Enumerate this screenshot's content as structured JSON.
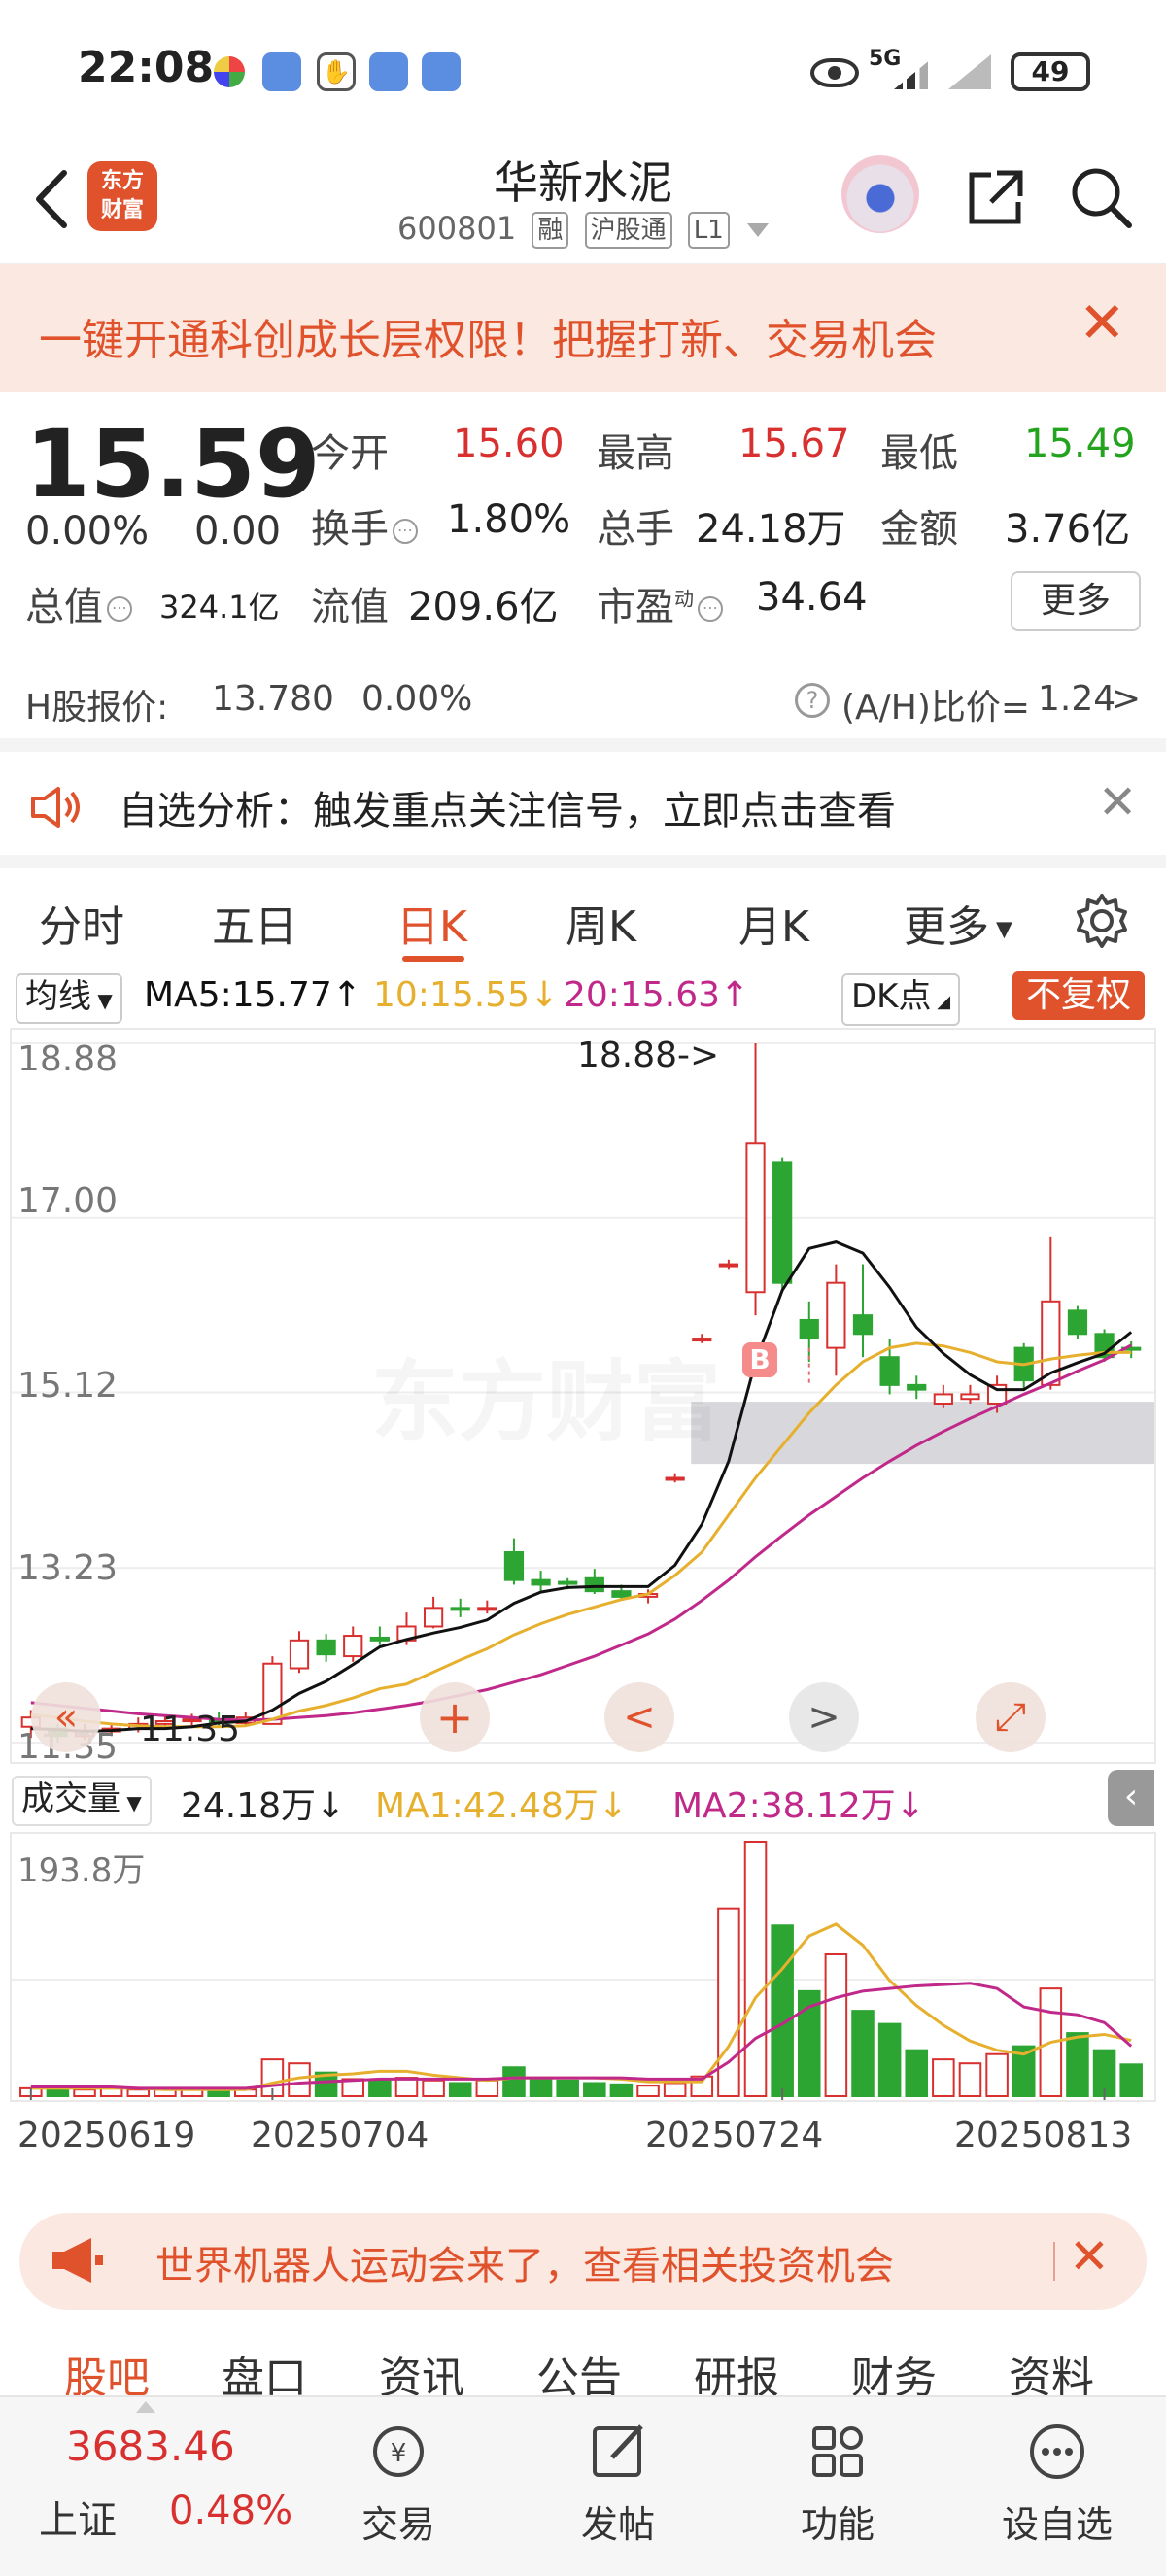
{
  "status_bar": {
    "time": "22:08",
    "network": "5G",
    "battery": "49"
  },
  "header": {
    "logo_line1": "东方",
    "logo_line2": "财富",
    "stock_name": "华新水泥",
    "stock_code": "600801",
    "tags": [
      "融",
      "沪股通",
      "L1"
    ]
  },
  "promo_banner": {
    "text": "一键开通科创成长层权限！把握打新、交易机会"
  },
  "quote": {
    "price": "15.59",
    "change_pct": "0.00%",
    "change": "0.00",
    "open_label": "今开",
    "open": "15.60",
    "high_label": "最高",
    "high": "15.67",
    "low_label": "最低",
    "low": "15.49",
    "turnover_label": "换手",
    "turnover": "1.80%",
    "volume_label": "总手",
    "volume": "24.18万",
    "amount_label": "金额",
    "amount": "3.76亿",
    "mktcap_label": "总值",
    "mktcap": "324.1亿",
    "float_label": "流值",
    "float": "209.6亿",
    "pe_label": "市盈",
    "pe_sup": "动",
    "pe": "34.64",
    "more": "更多"
  },
  "hk": {
    "label": "H股报价:",
    "price": "13.780",
    "pct": "0.00%",
    "ratio_label": "(A/H)比价=",
    "ratio": "1.24",
    "arrow": ">"
  },
  "analysis": {
    "text": "自选分析：触发重点关注信号，立即点击查看"
  },
  "tabs": [
    "分时",
    "五日",
    "日K",
    "周K",
    "月K",
    "更多"
  ],
  "ma_row": {
    "selector": "均线",
    "ma5": "MA5:15.77↑",
    "ma10": "10:15.55↓",
    "ma20": "20:15.63↑",
    "dk": "DK点",
    "fq": "不复权"
  },
  "colors": {
    "up": "#d8302f",
    "down": "#2da532",
    "accent": "#e0522c",
    "ma5": "#111111",
    "ma10": "#e6b02e",
    "ma20": "#c0288a"
  },
  "chart_data": [
    {
      "type": "candlestick",
      "y_ticks": [
        "18.88",
        "17.00",
        "15.12",
        "13.23",
        "11.35"
      ],
      "ylim": [
        11.35,
        18.88
      ],
      "max_label": "18.88->",
      "min_label": "11.35",
      "candles": [
        [
          11.52,
          11.62,
          11.7,
          11.4
        ],
        [
          11.5,
          11.42,
          11.55,
          11.35
        ],
        [
          11.42,
          11.48,
          11.55,
          11.38
        ],
        [
          11.47,
          11.5,
          11.56,
          11.42
        ],
        [
          11.5,
          11.55,
          11.62,
          11.46
        ],
        [
          11.55,
          11.58,
          11.64,
          11.5
        ],
        [
          11.58,
          11.6,
          11.66,
          11.52
        ],
        [
          11.6,
          11.56,
          11.68,
          11.52
        ],
        [
          11.56,
          11.62,
          11.68,
          11.52
        ],
        [
          11.55,
          12.2,
          12.28,
          11.55
        ],
        [
          12.15,
          12.45,
          12.55,
          12.1
        ],
        [
          12.45,
          12.3,
          12.52,
          12.22
        ],
        [
          12.28,
          12.5,
          12.6,
          12.22
        ],
        [
          12.48,
          12.45,
          12.6,
          12.4
        ],
        [
          12.45,
          12.6,
          12.75,
          12.4
        ],
        [
          12.6,
          12.8,
          12.92,
          12.58
        ],
        [
          12.8,
          12.78,
          12.9,
          12.7
        ],
        [
          12.78,
          12.8,
          12.88,
          12.74
        ],
        [
          13.4,
          13.1,
          13.55,
          13.05
        ],
        [
          13.1,
          13.05,
          13.2,
          12.98
        ],
        [
          13.08,
          13.06,
          13.12,
          13.0
        ],
        [
          13.12,
          12.98,
          13.22,
          12.95
        ],
        [
          12.98,
          12.92,
          13.05,
          12.88
        ],
        [
          12.92,
          12.95,
          13.0,
          12.85
        ],
        [
          14.2,
          14.2,
          14.25,
          14.15
        ],
        [
          15.7,
          15.7,
          15.75,
          15.65
        ],
        [
          16.5,
          16.5,
          16.55,
          16.45
        ],
        [
          16.2,
          17.8,
          18.88,
          15.95
        ],
        [
          17.6,
          16.3,
          17.65,
          16.2
        ],
        [
          15.9,
          15.7,
          16.1,
          15.45
        ],
        [
          15.6,
          16.3,
          16.5,
          15.3
        ],
        [
          15.95,
          15.75,
          16.5,
          15.5
        ],
        [
          15.5,
          15.2,
          15.7,
          15.1
        ],
        [
          15.2,
          15.15,
          15.3,
          15.05
        ],
        [
          15.0,
          15.1,
          15.2,
          14.95
        ],
        [
          15.05,
          15.1,
          15.2,
          15.0
        ],
        [
          15.0,
          15.2,
          15.3,
          14.9
        ],
        [
          15.6,
          15.25,
          15.65,
          15.15
        ],
        [
          15.2,
          16.1,
          16.8,
          15.15
        ],
        [
          16.0,
          15.75,
          16.05,
          15.7
        ],
        [
          15.75,
          15.5,
          15.8,
          15.45
        ],
        [
          15.6,
          15.59,
          15.67,
          15.49
        ]
      ],
      "ma5": [
        11.5,
        11.49,
        11.47,
        11.48,
        11.5,
        11.5,
        11.52,
        11.56,
        11.58,
        11.7,
        11.88,
        12.01,
        12.19,
        12.38,
        12.46,
        12.53,
        12.59,
        12.67,
        12.85,
        12.97,
        13.02,
        13.03,
        13.03,
        13.03,
        13.26,
        13.7,
        14.38,
        15.45,
        16.22,
        16.67,
        16.74,
        16.62,
        16.25,
        15.82,
        15.54,
        15.31,
        15.15,
        15.15,
        15.33,
        15.44,
        15.54,
        15.77
      ],
      "ma10": [
        11.65,
        11.62,
        11.58,
        11.55,
        11.53,
        11.52,
        11.52,
        11.52,
        11.53,
        11.6,
        11.69,
        11.75,
        11.83,
        11.93,
        11.98,
        12.11,
        12.24,
        12.36,
        12.51,
        12.63,
        12.73,
        12.81,
        12.89,
        12.95,
        13.15,
        13.4,
        13.8,
        14.2,
        14.55,
        14.9,
        15.2,
        15.45,
        15.6,
        15.65,
        15.62,
        15.55,
        15.45,
        15.42,
        15.48,
        15.52,
        15.55,
        15.55
      ],
      "ma20": [
        11.78,
        11.75,
        11.72,
        11.69,
        11.66,
        11.64,
        11.62,
        11.6,
        11.59,
        11.6,
        11.62,
        11.64,
        11.67,
        11.71,
        11.75,
        11.8,
        11.86,
        11.92,
        12.0,
        12.08,
        12.18,
        12.28,
        12.4,
        12.52,
        12.68,
        12.88,
        13.1,
        13.35,
        13.58,
        13.8,
        14.0,
        14.2,
        14.38,
        14.55,
        14.7,
        14.84,
        14.97,
        15.1,
        15.22,
        15.35,
        15.47,
        15.63
      ]
    },
    {
      "type": "bar",
      "name": "成交量",
      "ymax_label": "193.8万",
      "ylim": [
        0,
        193.8
      ],
      "values": [
        6,
        5,
        5,
        6,
        5,
        5,
        6,
        5,
        5,
        28,
        25,
        18,
        13,
        12,
        14,
        12,
        10,
        12,
        22,
        14,
        12,
        10,
        9,
        8,
        10,
        15,
        143,
        193.8,
        130,
        80,
        108,
        65,
        55,
        35,
        28,
        25,
        32,
        38,
        82,
        48,
        35,
        24.18
      ],
      "ma1": [
        6,
        6,
        6,
        6,
        6,
        5,
        5,
        5,
        5,
        10,
        14,
        16,
        17,
        19,
        19,
        16,
        14,
        12,
        14,
        14,
        14,
        14,
        13,
        11,
        11,
        11,
        38,
        75,
        97,
        122,
        131,
        115,
        88,
        69,
        54,
        42,
        35,
        32,
        41,
        45,
        47,
        42.48
      ],
      "ma2": [
        7,
        7,
        7,
        7,
        6,
        6,
        6,
        6,
        6,
        8,
        10,
        11,
        12,
        13,
        13,
        13,
        13,
        13,
        14,
        14,
        14,
        14,
        14,
        13,
        13,
        13,
        26,
        44,
        55,
        68,
        75,
        80,
        82,
        84,
        85,
        86,
        82,
        68,
        64,
        62,
        56,
        38.12
      ]
    }
  ],
  "volume": {
    "selector": "成交量",
    "current": "24.18万↓",
    "ma1": "MA1:42.48万↓",
    "ma2": "MA2:38.12万↓"
  },
  "dates": [
    "20250619",
    "20250704",
    "20250724",
    "20250813"
  ],
  "robot_banner": {
    "text": "世界机器人运动会来了，查看相关投资机会"
  },
  "sub_tabs": [
    "股吧",
    "盘口",
    "资讯",
    "公告",
    "研报",
    "财务",
    "资料"
  ],
  "bottom_bar": {
    "index_value": "3683.46",
    "index_name": "上证",
    "index_pct": "0.48%",
    "items": [
      "交易",
      "发帖",
      "功能",
      "设自选"
    ]
  },
  "overlay_buttons": [
    "+",
    "<",
    ">",
    "⤢"
  ],
  "signal_badge": "B"
}
